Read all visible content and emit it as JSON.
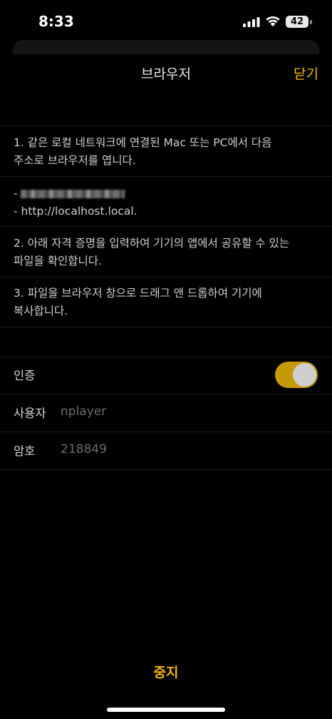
{
  "status": {
    "time": "8:33",
    "battery": "42"
  },
  "nav": {
    "title": "브라우저",
    "close_label": "닫기"
  },
  "instructions": {
    "step1_line1": "1. 같은 로컬 네트워크에 연결된 Mac 또는 PC에서 다음",
    "step1_line2": "주소로 브라우저를 엽니다.",
    "addr_prefix": "-",
    "addr_local": "- http://localhost.local.",
    "step2_line1": "2. 아래 자격 증명을 입력하여 기기의 앱에서 공유할 수 있는",
    "step2_line2": "파일을 확인합니다.",
    "step3_line1": "3. 파일을 브라우저 창으로 드래그 앤 드롭하여 기기에",
    "step3_line2": "복사합니다."
  },
  "settings": {
    "auth_label": "인증",
    "auth_enabled": true,
    "user_label": "사용자",
    "user_value": "nplayer",
    "password_label": "암호",
    "password_value": "218849"
  },
  "footer": {
    "stop_label": "중지"
  },
  "colors": {
    "accent": "#f2b705",
    "toggle_on": "#c49a06",
    "background": "#000000"
  }
}
